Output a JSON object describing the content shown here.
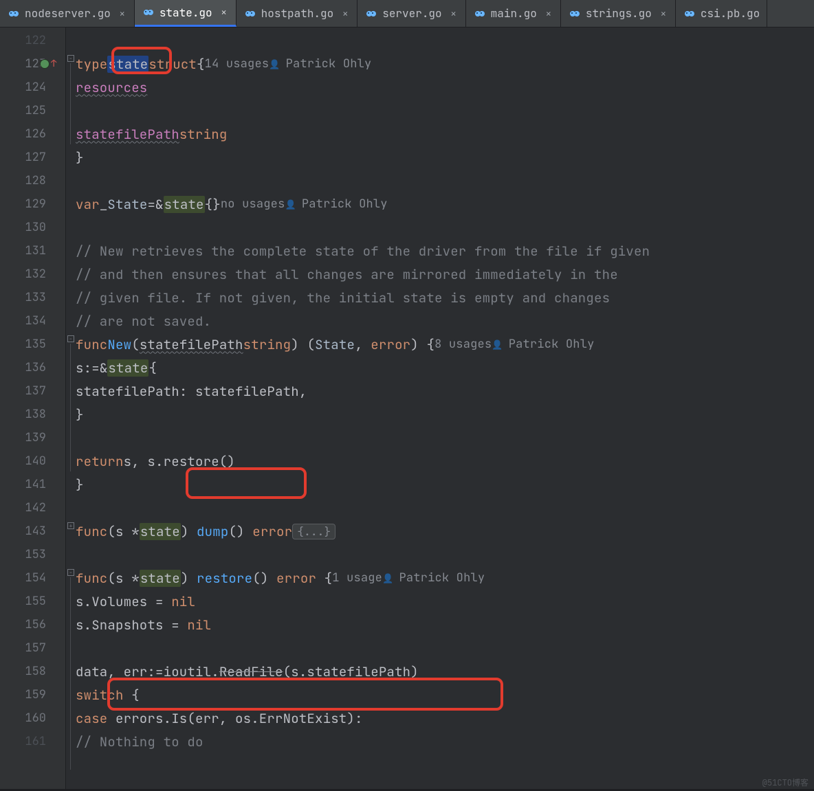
{
  "tabs": [
    {
      "label": "nodeserver.go",
      "active": false
    },
    {
      "label": "state.go",
      "active": true
    },
    {
      "label": "hostpath.go",
      "active": false
    },
    {
      "label": "server.go",
      "active": false
    },
    {
      "label": "main.go",
      "active": false
    },
    {
      "label": "strings.go",
      "active": false
    },
    {
      "label": "csi.pb.go",
      "active": false
    }
  ],
  "close_glyph": "×",
  "line_numbers": [
    "122",
    "123",
    "124",
    "125",
    "126",
    "127",
    "128",
    "129",
    "130",
    "131",
    "132",
    "133",
    "134",
    "135",
    "136",
    "137",
    "138",
    "139",
    "140",
    "141",
    "142",
    "143",
    "153",
    "154",
    "155",
    "156",
    "157",
    "158",
    "159",
    "160",
    "161"
  ],
  "gutter_marks": {
    "green_on": "123",
    "arrow_on": "123"
  },
  "author": "Patrick Ohly",
  "hints": {
    "type_state": "14 usages",
    "var_state": "no usages",
    "func_new": "8 usages",
    "func_restore": "1 usage"
  },
  "foldbadge": "{...}",
  "watermark": "@51CTO博客",
  "code": {
    "l123": {
      "kw": "type",
      "name": "state",
      "kw2": "struct",
      "open": "{"
    },
    "l124": {
      "field": "resources"
    },
    "l126": {
      "field": "statefilePath",
      "type": "string"
    },
    "l127": {
      "close": "}"
    },
    "l129": {
      "kw": "var",
      "blank": "_",
      "typ": "State",
      "eq": "=",
      "amp": "&",
      "name": "state",
      "braces": "{}"
    },
    "l131": "// New retrieves the complete state of the driver from the file if given",
    "l132": "// and then ensures that all changes are mirrored immediately in the",
    "l133": "// given file. If not given, the initial state is empty and changes",
    "l134": "// are not saved.",
    "l135": {
      "kw": "func",
      "name": "New",
      "p_open": "(",
      "param": "statefilePath",
      "ptype": "string",
      "p_mid": ") (",
      "ret1": "State",
      "comma": ", ",
      "ret2": "error",
      "p_close": ") {"
    },
    "l136": {
      "lhs": "s",
      "op": ":=",
      "amp": "&",
      "name": "state",
      "open": "{"
    },
    "l137": {
      "field": "statefilePath",
      "colon": ": ",
      "val": "statefilePath",
      "comma": ","
    },
    "l138": {
      "close": "}"
    },
    "l140": {
      "kw": "return",
      "s": "s",
      "comma": ", ",
      "call": "s.restore()"
    },
    "l141": {
      "close": "}"
    },
    "l143": {
      "kw": "func",
      "recv": "(s *",
      "name": "state",
      "r_close": ") ",
      "fn": "dump",
      "sig": "() ",
      "ret": "error"
    },
    "l154": {
      "kw": "func",
      "recv": "(s *",
      "name": "state",
      "r_close": ") ",
      "fn": "restore",
      "sig": "() ",
      "ret": "error",
      "open": " {"
    },
    "l155": {
      "txt": "s.Volumes = ",
      "nil": "nil"
    },
    "l156": {
      "txt": "s.Snapshots = ",
      "nil": "nil"
    },
    "l158": {
      "lhs": "data, err",
      "op": ":=",
      "pkg": "ioutil.",
      "fn": "ReadFile",
      "arg": "(s.statefilePath)"
    },
    "l159": {
      "kw": "switch",
      "open": " {"
    },
    "l160": {
      "kw": "case",
      "expr": " errors.Is(err, os.ErrNotExist):"
    },
    "l161": "// Nothing to do"
  }
}
